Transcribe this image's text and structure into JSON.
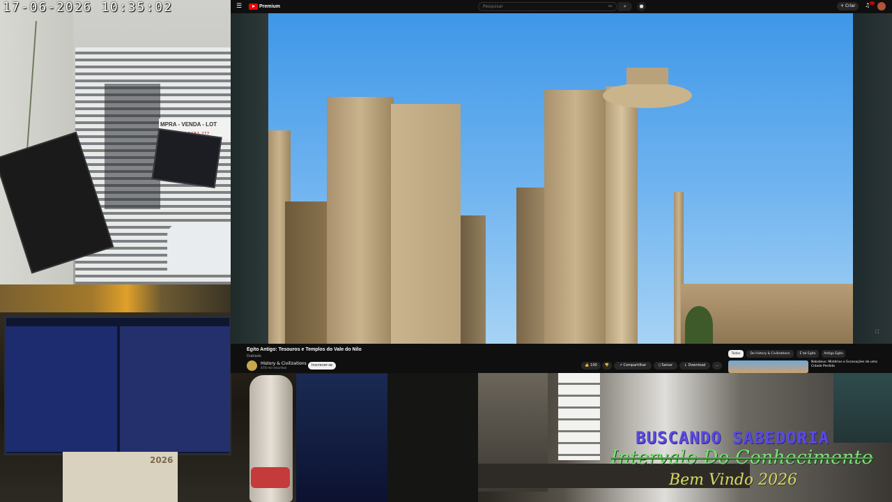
{
  "camera": {
    "timestamp": "17-06-2026 10:35:02",
    "sign_text": "MPRA - VENDA - LOT",
    "sign_phone": "96 9651 ???"
  },
  "monitor": {
    "calendar_year": "2026"
  },
  "youtube": {
    "logo_text": "Premium",
    "search_placeholder": "Pesquisar",
    "create_label": "Criar",
    "video": {
      "title": "Egito Antigo: Tesouros e Templos do Vale do Nilo",
      "subtitle": "Dublado"
    },
    "channel": {
      "name": "History & Civilizations",
      "subscribers": "470 mil inscritos",
      "subscribe_label": "Inscrever-se"
    },
    "actions": {
      "likes": "100",
      "share": "Compartilhar",
      "save": "Salvar",
      "download": "Download",
      "more": "..."
    },
    "chips": [
      "Todos",
      "Do History & Civilizations",
      "É tal Egito",
      "Antigo Egito"
    ],
    "recommendation": {
      "title": "Nabateus: Mistérios e Escavações de uma Cidade Perdida"
    }
  },
  "overlay": {
    "line1": "BUSCANDO SABEDORIA",
    "line2": "Intervalo Do Conhecimento",
    "line3": "Bem Vindo 2026"
  },
  "colors": {
    "youtube_red": "#ff0000",
    "overlay_purple": "#5b4bdc",
    "overlay_green": "#7fe07a",
    "overlay_yellow": "#d7d75c"
  }
}
